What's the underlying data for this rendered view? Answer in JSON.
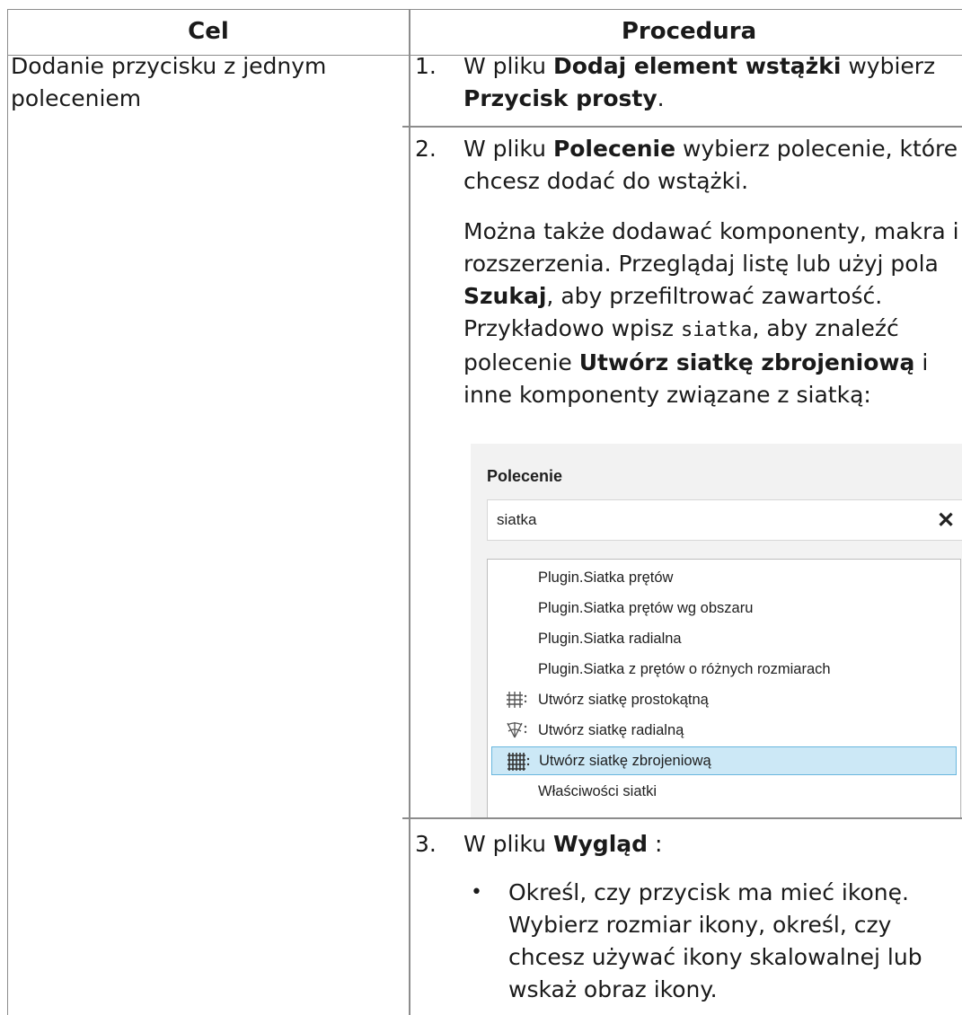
{
  "table": {
    "headers": {
      "goal": "Cel",
      "procedure": "Procedura"
    },
    "goal": "Dodanie przycisku z jednym poleceniem",
    "steps": {
      "s1": {
        "num": "1.",
        "t1": "W pliku ",
        "b1": "Dodaj element wstążki",
        "t2": " wybierz ",
        "b2": "Przycisk prosty",
        "t3": "."
      },
      "s2": {
        "num": "2.",
        "t1": "W pliku ",
        "b1": "Polecenie",
        "t2": " wybierz polecenie, które chcesz dodać do wstążki.",
        "p_t1": "Można także dodawać komponenty, makra i rozszerzenia. Przeglądaj listę lub użyj pola ",
        "p_b1": "Szukaj",
        "p_t2": ", aby przefiltrować zawartość. Przykładowo wpisz ",
        "p_code": "siatka",
        "p_t3": ", aby znaleźć polecenie ",
        "p_b2": "Utwórz siatkę zbrojeniową",
        "p_t4": " i inne komponenty związane z siatką:"
      },
      "s3": {
        "num": "3.",
        "t1": "W pliku ",
        "b1": "Wygląd",
        "t2": " :",
        "bullet": "•",
        "bullet_text": "Określ, czy przycisk ma mieć ikonę. Wybierz rozmiar ikony, określ, czy chcesz używać ikony skalowalnej lub wskaż obraz ikony."
      }
    }
  },
  "screenshot": {
    "title": "Polecenie",
    "search_value": "siatka",
    "clear_glyph": "✕",
    "items": [
      {
        "label": "Plugin.Siatka prętów",
        "icon": ""
      },
      {
        "label": "Plugin.Siatka prętów wg obszaru",
        "icon": ""
      },
      {
        "label": "Plugin.Siatka radialna",
        "icon": ""
      },
      {
        "label": "Plugin.Siatka z prętów o różnych rozmiarach",
        "icon": ""
      },
      {
        "label": "Utwórz siatkę prostokątną",
        "icon": "rectangular-grid-icon"
      },
      {
        "label": "Utwórz siatkę radialną",
        "icon": "radial-grid-icon"
      },
      {
        "label": "Utwórz siatkę zbrojeniową",
        "icon": "rebar-mesh-icon",
        "selected": true
      },
      {
        "label": "Właściwości siatki",
        "icon": ""
      }
    ],
    "colors": {
      "selection_fill": "#cce8f6",
      "selection_border": "#69b7de",
      "panel_bg": "#f2f2f2"
    }
  }
}
